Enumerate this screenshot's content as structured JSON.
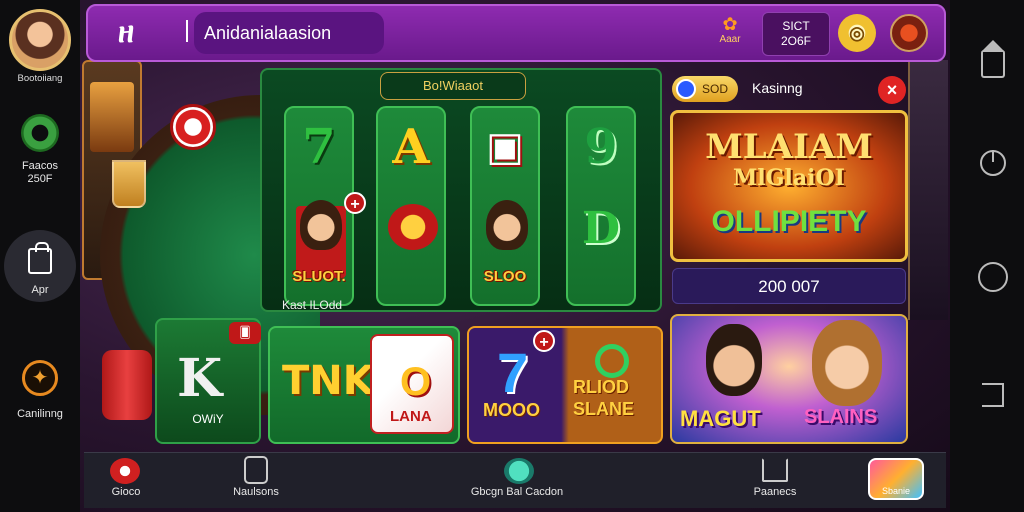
{
  "profile": {
    "name": "Bootoiiang"
  },
  "left_rail": {
    "items": [
      {
        "label": "Faacos",
        "sub": "250F",
        "icon": "gear-icon"
      },
      {
        "label": "Apr",
        "icon": "bag-icon"
      },
      {
        "label": "Canilinng",
        "icon": "leaf-icon"
      }
    ]
  },
  "topbar": {
    "logo_glyph": "ዘ",
    "title": "Anidanialaasion",
    "stat_label": "Aaar",
    "stat_glyph": "✿",
    "balance_line1": "SICT",
    "balance_line2": "2O6F",
    "coin_glyph": "◎"
  },
  "main_panel": {
    "header": "Bo!Wiaaot",
    "caption": "Kast ILOdd",
    "tiles": [
      {
        "symbol": "7",
        "color": "#2fc040",
        "label": "SLUOT.",
        "has_plus": true
      },
      {
        "symbol": "A",
        "color": "#ffd020",
        "label": "",
        "has_plus": false
      },
      {
        "symbol": "▣",
        "color": "#ffffff",
        "label": "SLOO",
        "has_plus": false
      },
      {
        "symbol": "9",
        "color": "#1ea040",
        "label": "",
        "has_plus": false
      }
    ],
    "tile4_bottom_symbol": "D"
  },
  "bottom_tiles": {
    "k": {
      "symbol": "K",
      "label": "OWiY",
      "badge": "🂠"
    },
    "lana": {
      "left": "TNK",
      "mid": "O",
      "label": "LANA"
    },
    "mood": {
      "seven": "7",
      "left_label": "MOOO",
      "right_label_1": "RLIOD",
      "right_label_2": "SLANE",
      "plus": "+"
    }
  },
  "right_panel": {
    "coin_amount": "SOD",
    "title": "Kasinng",
    "close": "×",
    "banner_line1": "MLAIAM",
    "banner_line2": "MlGlaiOI",
    "banner_line3": "OLLIPIETY",
    "amount": "200 007",
    "promo_left": "MAGUT",
    "promo_right": "SLAINS"
  },
  "bottombar": {
    "items": [
      {
        "label": "Gioco",
        "icon": "chip-icon"
      },
      {
        "label": "Naulsons",
        "icon": "phone-icon"
      },
      {
        "label": "Gbcgn Bal Cacdon",
        "icon": "bird-icon"
      },
      {
        "label": "Paanecs",
        "icon": "home-icon"
      }
    ],
    "store_label": "Sbanie"
  }
}
